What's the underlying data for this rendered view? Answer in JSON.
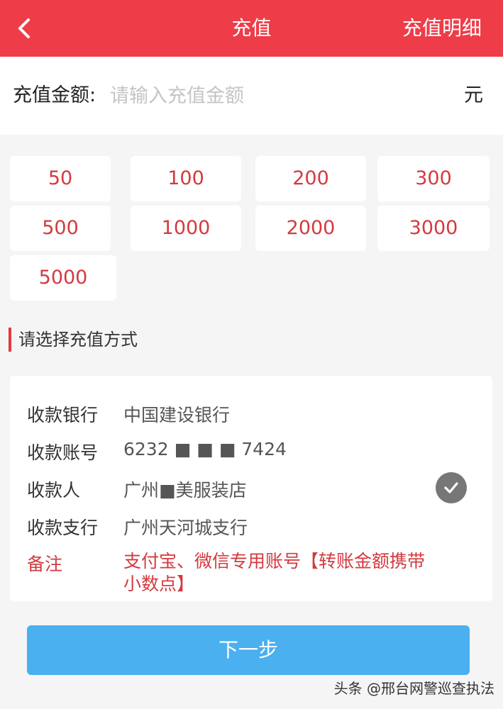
{
  "header": {
    "title": "充值",
    "detail_link": "充值明细",
    "back_icon": "chevron-left-icon",
    "background_color": "#ee3d48"
  },
  "amount": {
    "label": "充值金额:",
    "placeholder": "请输入充值金额",
    "unit": "元"
  },
  "presets": [
    "50",
    "100",
    "200",
    "300",
    "500",
    "1000",
    "2000",
    "3000",
    "5000"
  ],
  "method_section": {
    "title": "请选择充值方式"
  },
  "payment_info": {
    "bank_label": "收款银行",
    "bank_value": "中国建设银行",
    "account_label": "收款账号",
    "account_value": "6232 ■ ■ ■ 7424",
    "payee_label": "收款人",
    "payee_value": "广州■美服装店",
    "branch_label": "收款支行",
    "branch_value": "广州天河城支行",
    "note_label": "备注",
    "note_value": "支付宝、微信专用账号【转账金额携带小数点】",
    "selected_icon": "check-circle-icon"
  },
  "next_button": {
    "label": "下一步",
    "color": "#4ab0f0"
  },
  "watermark": "头条 @邢台网警巡查执法"
}
